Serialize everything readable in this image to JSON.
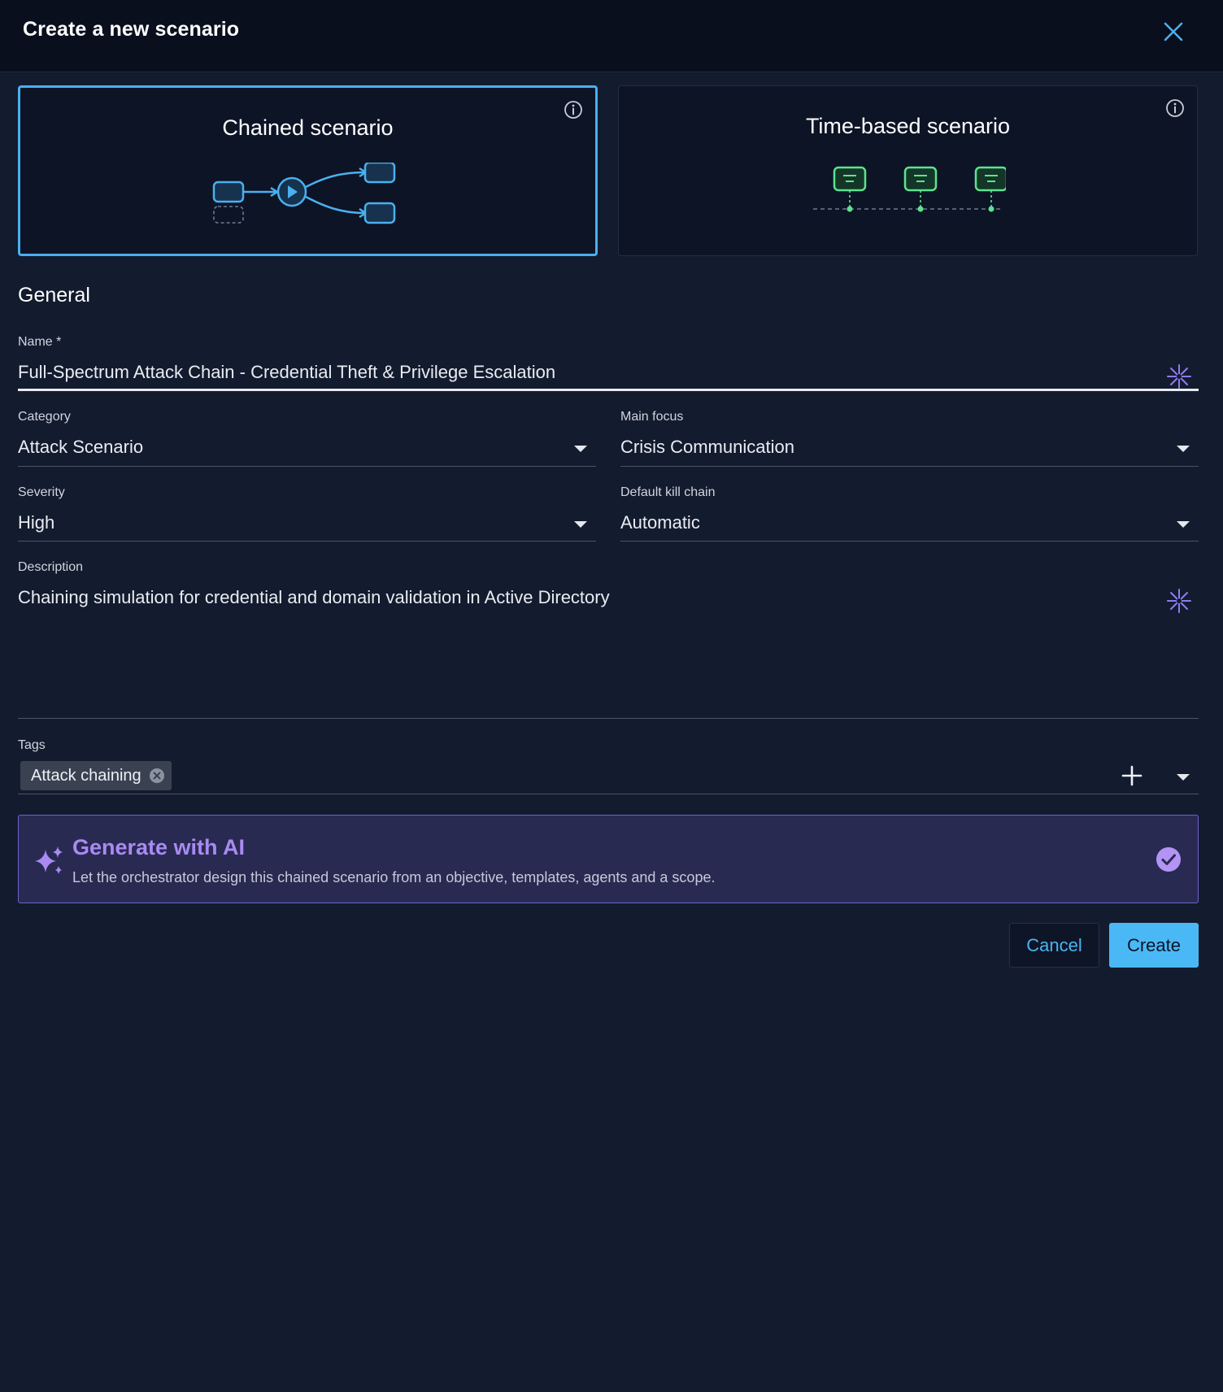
{
  "dialog": {
    "title": "Create a new scenario"
  },
  "scenario_types": {
    "chained": {
      "label": "Chained scenario",
      "selected": true
    },
    "time_based": {
      "label": "Time-based scenario",
      "selected": false
    }
  },
  "section": {
    "general": "General"
  },
  "fields": {
    "name": {
      "label": "Name *",
      "value": "Full-Spectrum Attack Chain - Credential Theft & Privilege Escalation"
    },
    "category": {
      "label": "Category",
      "value": "Attack Scenario"
    },
    "main_focus": {
      "label": "Main focus",
      "value": "Crisis Communication"
    },
    "severity": {
      "label": "Severity",
      "value": "High"
    },
    "kill_chain": {
      "label": "Default kill chain",
      "value": "Automatic"
    },
    "description": {
      "label": "Description",
      "value": "Chaining simulation for credential and domain validation in Active Directory"
    },
    "tags": {
      "label": "Tags",
      "items": [
        "Attack chaining"
      ]
    }
  },
  "ai": {
    "title": "Generate with AI",
    "description": "Let the orchestrator design this chained scenario from an objective, templates, agents and a scope.",
    "checked": true
  },
  "actions": {
    "cancel": "Cancel",
    "create": "Create"
  },
  "colors": {
    "accent": "#4ab8f5",
    "ai_purple": "#a98af2",
    "chained_illustration": "#4ab0ee",
    "time_illustration": "#5de38d"
  }
}
